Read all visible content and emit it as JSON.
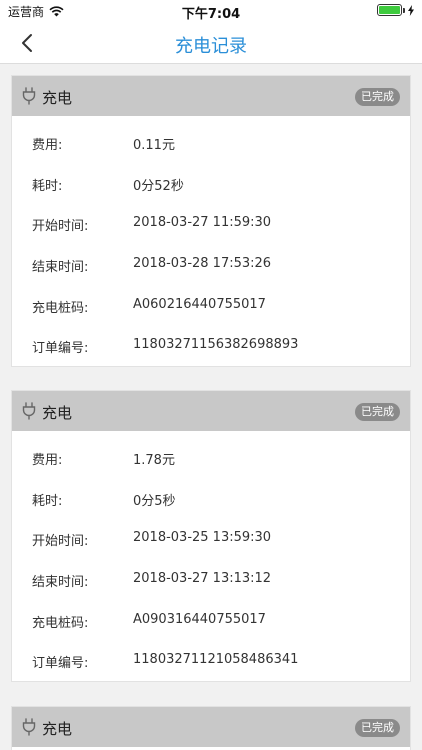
{
  "status_bar": {
    "carrier": "运营商",
    "time": "下午7:04"
  },
  "nav": {
    "title": "充电记录"
  },
  "labels": {
    "fee": "费用:",
    "duration": "耗时:",
    "start": "开始时间:",
    "end": "结束时间:",
    "pile": "充电桩码:",
    "order": "订单编号:"
  },
  "records": [
    {
      "type": "充电",
      "status": "已完成",
      "fee": "0.11元",
      "duration": "0分52秒",
      "start": "2018-03-27 11:59:30",
      "end": "2018-03-28 17:53:26",
      "pile": "A060216440755017",
      "order": "11803271156382698893"
    },
    {
      "type": "充电",
      "status": "已完成",
      "fee": "1.78元",
      "duration": "0分5秒",
      "start": "2018-03-25 13:59:30",
      "end": "2018-03-27 13:13:12",
      "pile": "A090316440755017",
      "order": "11803271121058486341"
    },
    {
      "type": "充电",
      "status": "已完成"
    }
  ],
  "colors": {
    "accent": "#2b8fd8",
    "header_bg": "#c8c8c8",
    "badge_bg": "#8a8a8a",
    "battery": "#3ecb3e"
  },
  "icons": {
    "back": "chevron-left-icon",
    "plug": "plug-icon",
    "wifi": "wifi-icon",
    "battery": "battery-icon"
  }
}
